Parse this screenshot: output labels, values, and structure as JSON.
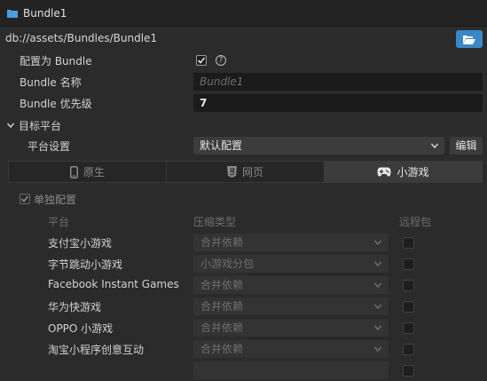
{
  "header": {
    "title": "Bundle1",
    "icon": "folder-icon"
  },
  "path": {
    "text": "db://assets/Bundles/Bundle1",
    "open_icon": "folder-open-icon"
  },
  "props": {
    "is_bundle": {
      "label": "配置为 Bundle",
      "checked": true
    },
    "name": {
      "label": "Bundle 名称",
      "placeholder": "Bundle1"
    },
    "priority": {
      "label": "Bundle 优先级",
      "value": "7"
    }
  },
  "target": {
    "section_label": "目标平台",
    "settings_label": "平台设置",
    "settings_value": "默认配置",
    "edit_label": "编辑"
  },
  "tabs": [
    {
      "label": "原生",
      "icon": "mobile-icon",
      "active": false
    },
    {
      "label": "网页",
      "icon": "html5-icon",
      "active": false
    },
    {
      "label": "小游戏",
      "icon": "gamepad-icon",
      "active": true
    }
  ],
  "minigame": {
    "override_label": "单独配置",
    "override_checked": true,
    "columns": {
      "platform": "平台",
      "compression": "压缩类型",
      "remote": "远程包"
    },
    "rows": [
      {
        "platform": "支付宝小游戏",
        "compression": "合并依赖",
        "remote": false
      },
      {
        "platform": "字节跳动小游戏",
        "compression": "小游戏分包",
        "remote": false
      },
      {
        "platform": "Facebook Instant Games",
        "compression": "合并依赖",
        "remote": false
      },
      {
        "platform": "华为快游戏",
        "compression": "合并依赖",
        "remote": false
      },
      {
        "platform": "OPPO 小游戏",
        "compression": "合并依赖",
        "remote": false
      },
      {
        "platform": "淘宝小程序创意互动",
        "compression": "合并依赖",
        "remote": false
      },
      {
        "platform": "",
        "compression": "",
        "remote": false
      }
    ]
  },
  "colors": {
    "accent": "#3a88c8",
    "background": "#2b2b2b",
    "titlebar": "#232323"
  }
}
